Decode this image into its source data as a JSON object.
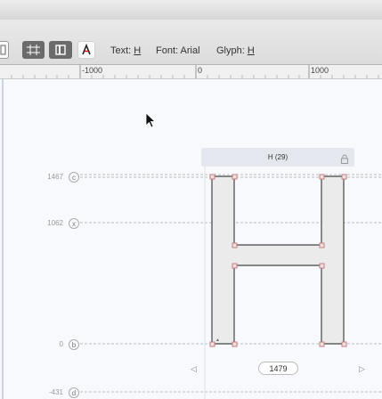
{
  "toolbar": {
    "text_label": "Text:",
    "text_value": "H",
    "font_label": "Font:",
    "font_value": "Arial",
    "glyph_label": "Glyph:",
    "glyph_value": "H",
    "icon_names": [
      "sidebar-toggle-icon",
      "metrics-view-icon",
      "kerning-view-icon",
      "glyph-info-icon"
    ]
  },
  "ruler": {
    "labels": [
      "-1000",
      "0",
      "1000"
    ]
  },
  "metrics": [
    {
      "value": "1467",
      "badge": "c"
    },
    {
      "value": "1062",
      "badge": "x"
    },
    {
      "value": "0",
      "badge": "b"
    },
    {
      "value": "-431",
      "badge": "d"
    }
  ],
  "glyph": {
    "header": "H (29)",
    "width": "1479"
  },
  "colors": {
    "outline": "#444444",
    "fill": "#ebebeb",
    "point": "#c08080",
    "guide": "#bbbbbb"
  }
}
